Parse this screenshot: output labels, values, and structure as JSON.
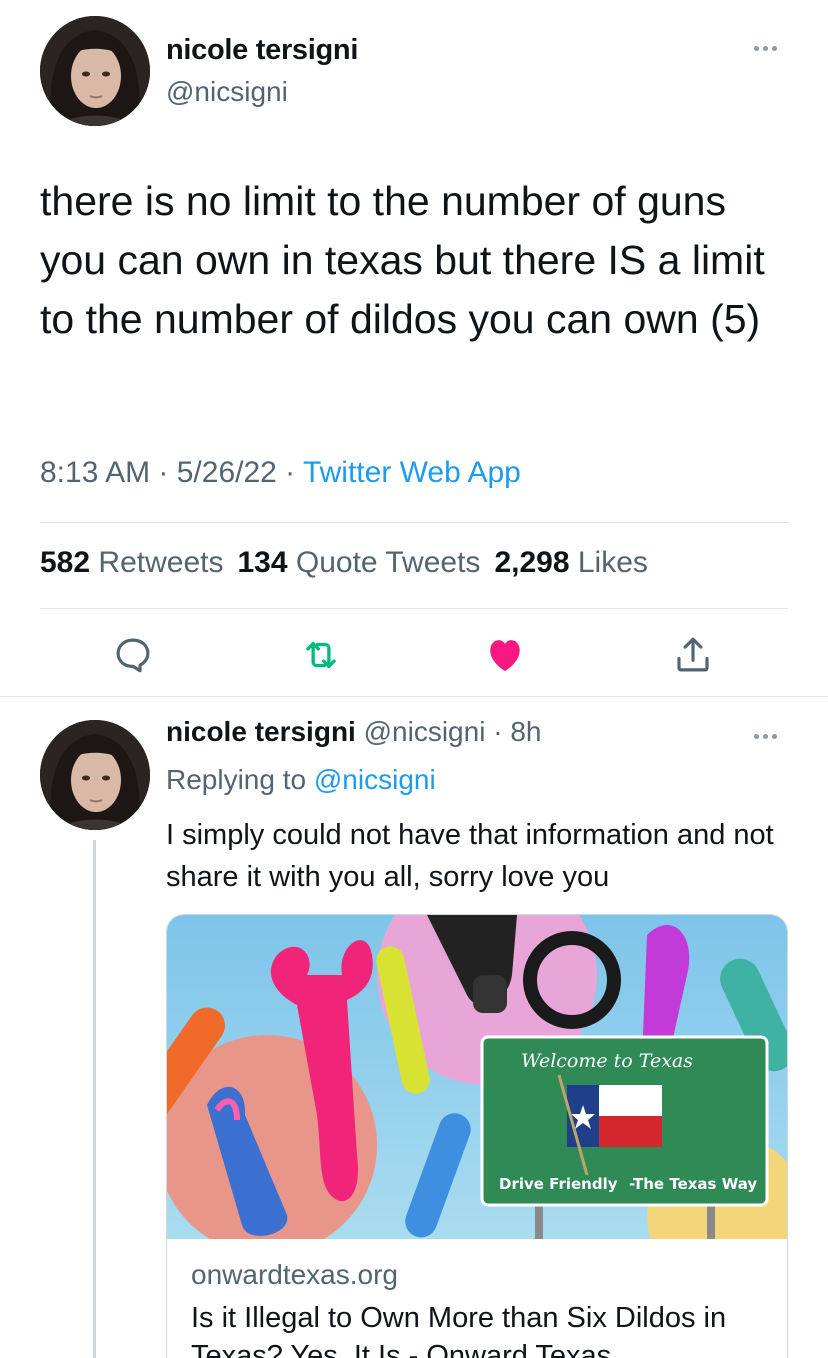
{
  "main_tweet": {
    "author_name": "nicole tersigni",
    "author_handle": "@nicsigni",
    "text": "there is no limit to the number of guns you can own in texas but there IS a limit to the number of dildos you can own (5)",
    "time": "8:13 AM",
    "date": "5/26/22",
    "source": "Twitter Web App",
    "separator": " · "
  },
  "stats": {
    "retweets_count": "582",
    "retweets_label": "Retweets",
    "quotes_count": "134",
    "quotes_label": "Quote Tweets",
    "likes_count": "2,298",
    "likes_label": "Likes"
  },
  "actions": {
    "reply_icon": "reply-icon",
    "retweet_icon": "retweet-icon",
    "like_icon": "heart-icon",
    "share_icon": "share-icon",
    "liked": true,
    "retweet_color": "#00ba7c",
    "like_color": "#f91880"
  },
  "reply": {
    "author_name": "nicole tersigni",
    "author_handle": "@nicsigni",
    "time_ago": "8h",
    "separator": " · ",
    "replying_to_prefix": "Replying to",
    "replying_to_handle": "@nicsigni",
    "text": "I simply could not have that information and not share it with you all, sorry love you"
  },
  "link_card": {
    "sign_title": "Welcome to Texas",
    "sign_left": "Drive Friendly",
    "sign_right": "-The Texas Way",
    "domain": "onwardtexas.org",
    "title": "Is it Illegal to Own More than Six Dildos in Texas? Yes, It Is - Onward Texas"
  },
  "colors": {
    "link_blue": "#1d9bf0",
    "secondary_text": "#536471",
    "primary_text": "#0f1419",
    "divider": "#e1e6ea"
  }
}
